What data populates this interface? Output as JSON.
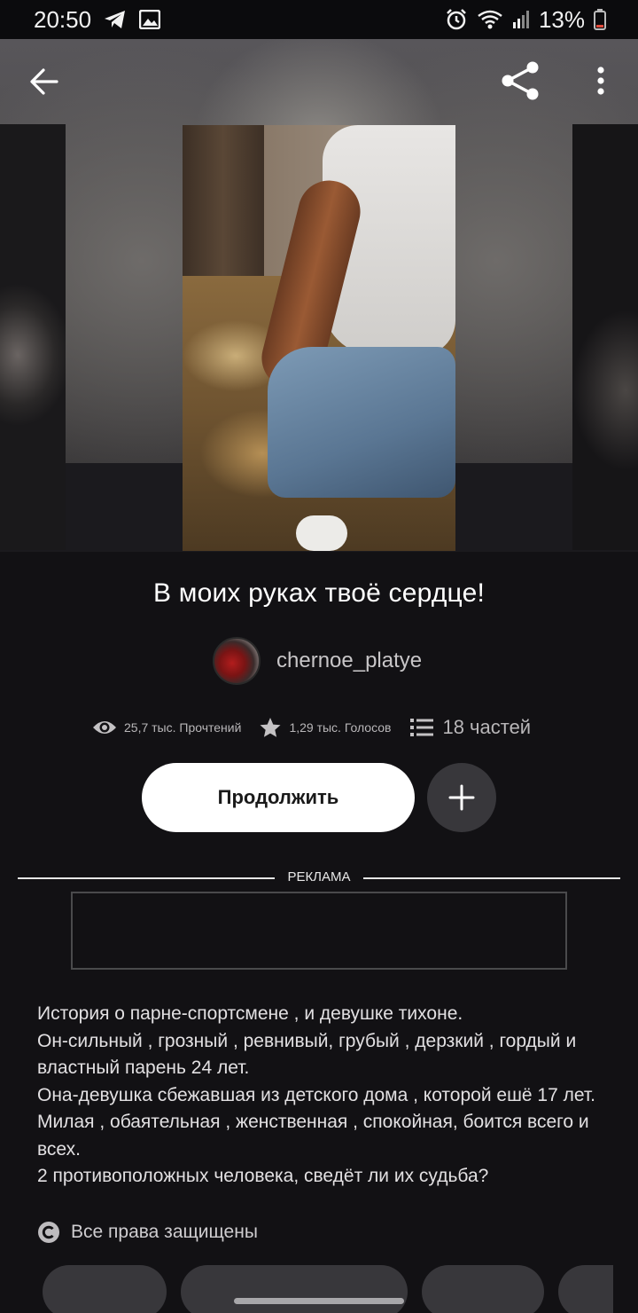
{
  "status_bar": {
    "time": "20:50",
    "battery_percent": "13%",
    "icons": [
      "telegram-icon",
      "gallery-icon",
      "alarm-icon",
      "wifi-icon",
      "signal-icon",
      "battery-icon"
    ]
  },
  "toolbar": {
    "icons": [
      "arrow-left-icon",
      "share-icon",
      "more-vertical-icon"
    ]
  },
  "story": {
    "title": "В моих руках твоё сердце!",
    "author": "chernoe_platye",
    "reads": "25,7 тыс. Прочтений",
    "votes": "1,29 тыс. Голосов",
    "parts": "18 частей",
    "continue_label": "Продолжить",
    "description": [
      "История о  парне-спортсмене , и девушке тихоне.",
      "Он-сильный , грозный , ревнивый, грубый , дерзкий , гордый и властный парень 24 лет.",
      "Она-девушка сбежавшая из детского дома , которой ешё 17 лет. Милая , обаятельная , женственная , спокойная, боится всего и всех.",
      "2 противоположных человека, сведёт ли их судьба?"
    ],
    "copyright": "Все права защищены"
  },
  "ad": {
    "label": "РЕКЛАМА"
  },
  "colors": {
    "background": "#121114",
    "button_primary": "#ffffff",
    "button_secondary": "#38373b",
    "text_muted": "#b8b6b8"
  }
}
